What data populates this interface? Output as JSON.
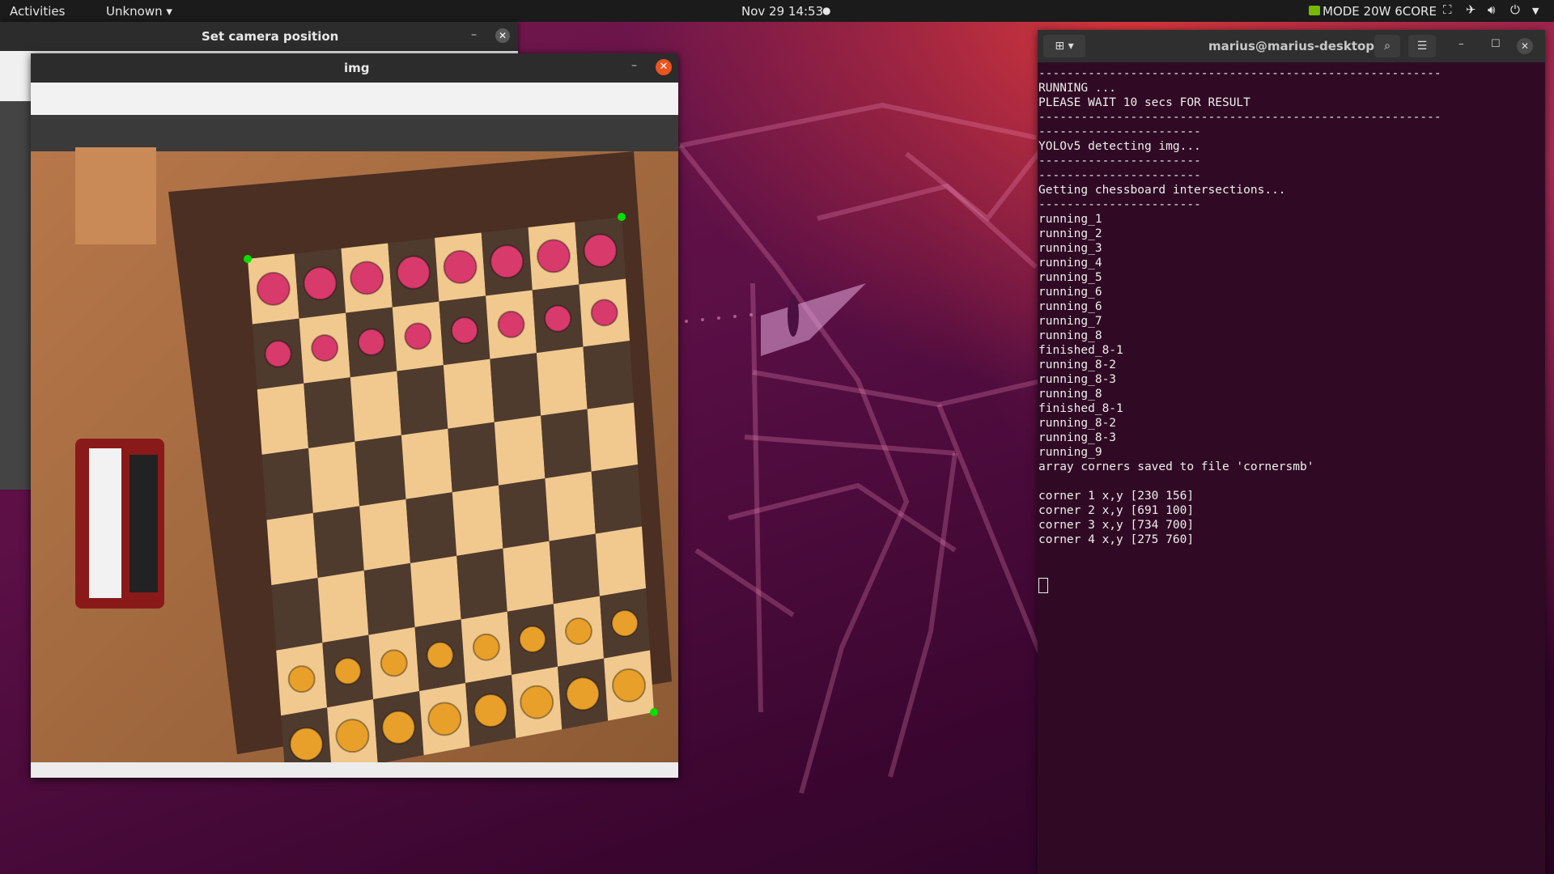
{
  "topbar": {
    "activities": "Activities",
    "app_menu": "Unknown ▾",
    "clock": "Nov 29  14:53",
    "notification_dot": "●",
    "gpu_mode": "MODE 20W 6CORE",
    "icons": [
      "nvidia-icon",
      "network-icon",
      "airplane-icon",
      "volume-icon",
      "power-icon",
      "chevron-down-icon"
    ]
  },
  "camera_window": {
    "title": "Set camera position",
    "minimize": "–",
    "close": "✕"
  },
  "img_window": {
    "title": "img",
    "minimize": "–",
    "close": "✕",
    "image": {
      "subject": "chessboard-top-view",
      "marker_color": "#00e000",
      "marker_count": 4
    }
  },
  "terminal": {
    "title": "marius@marius-desktop: ~",
    "lines": [
      "---------------------------------------------------------",
      "RUNNING ...",
      "PLEASE WAIT 10 secs FOR RESULT",
      "---------------------------------------------------------",
      "-----------------------",
      "YOLOv5 detecting img...",
      "-----------------------",
      "-----------------------",
      "Getting chessboard intersections...",
      "-----------------------",
      "running_1",
      "running_2",
      "running_3",
      "running_4",
      "running_5",
      "running_6",
      "running_6",
      "running_7",
      "running_8",
      "finished_8-1",
      "running_8-2",
      "running_8-3",
      "running_8",
      "finished_8-1",
      "running_8-2",
      "running_8-3",
      "running_9",
      "array corners saved to file 'cornersmb'",
      "",
      "corner 1 x,y [230 156]",
      "corner 2 x,y [691 100]",
      "corner 3 x,y [734 700]",
      "corner 4 x,y [275 760]"
    ]
  },
  "colors": {
    "topbar_bg": "#1b1b1b",
    "terminal_bg": "#300a24",
    "close_accent": "#e9541f"
  }
}
